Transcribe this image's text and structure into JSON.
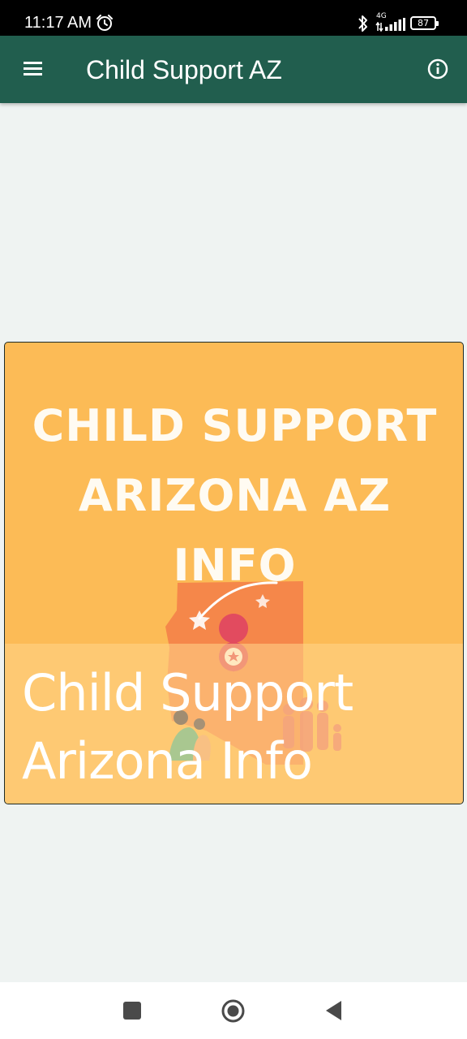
{
  "status_bar": {
    "time": "11:17 AM",
    "network_type": "4G",
    "battery_level": "87",
    "icons": [
      "alarm-icon",
      "bluetooth-icon",
      "data-arrows-icon",
      "signal-icon",
      "battery-icon"
    ]
  },
  "app_bar": {
    "title": "Child Support AZ",
    "menu_icon": "hamburger-menu-icon",
    "info_icon": "info-circle-icon",
    "background": "#215e4e"
  },
  "card": {
    "headline_line1": "CHILD SUPPORT",
    "headline_line2": "ARIZONA AZ",
    "headline_line3": "INFO",
    "caption_line1": "Child Support",
    "caption_line2": "Arizona Info",
    "background": "#fcbb56"
  },
  "nav_bar": {
    "icons": [
      "recents-square-icon",
      "home-circle-icon",
      "back-triangle-icon"
    ]
  }
}
